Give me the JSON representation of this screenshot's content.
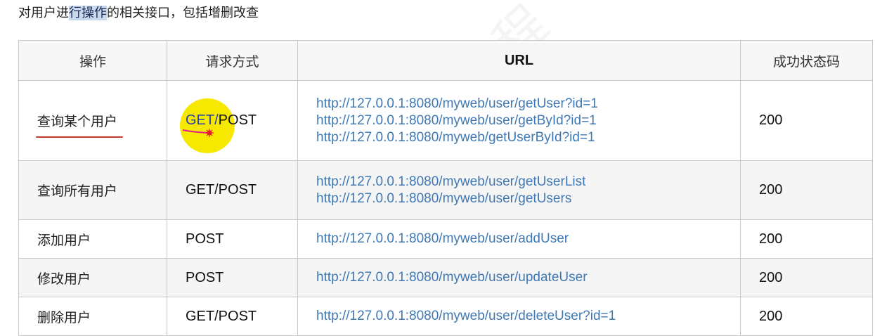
{
  "intro": {
    "before": "对用户进",
    "highlight": "行操作",
    "after": "的相关接口，包括增删改查"
  },
  "table": {
    "headers": {
      "operation": "操作",
      "method": "请求方式",
      "url": "URL",
      "status": "成功状态码"
    },
    "rows": [
      {
        "operation": "查询某个用户",
        "method_get": "GET/",
        "method_post": "POST",
        "urls": [
          "http://127.0.0.1:8080/myweb/user/getUser?id=1",
          "http://127.0.0.1:8080/myweb/user/getById?id=1",
          "http://127.0.0.1:8080/myweb/getUserById?id=1"
        ],
        "status": "200"
      },
      {
        "operation": "查询所有用户",
        "method": "GET/POST",
        "urls": [
          "http://127.0.0.1:8080/myweb/user/getUserList",
          "http://127.0.0.1:8080/myweb/user/getUsers"
        ],
        "status": "200"
      },
      {
        "operation": "添加用户",
        "method": "POST",
        "urls": [
          "http://127.0.0.1:8080/myweb/user/addUser"
        ],
        "status": "200"
      },
      {
        "operation": "修改用户",
        "method": "POST",
        "urls": [
          "http://127.0.0.1:8080/myweb/user/updateUser"
        ],
        "status": "200"
      },
      {
        "operation": "删除用户",
        "method": "GET/POST",
        "urls": [
          "http://127.0.0.1:8080/myweb/user/deleteUser?id=1"
        ],
        "status": "200"
      }
    ]
  },
  "colors": {
    "link": "#3e78b5",
    "highlight": "#c9d9ee",
    "cursor": "#f7e800",
    "annotation": "#c0392b"
  }
}
